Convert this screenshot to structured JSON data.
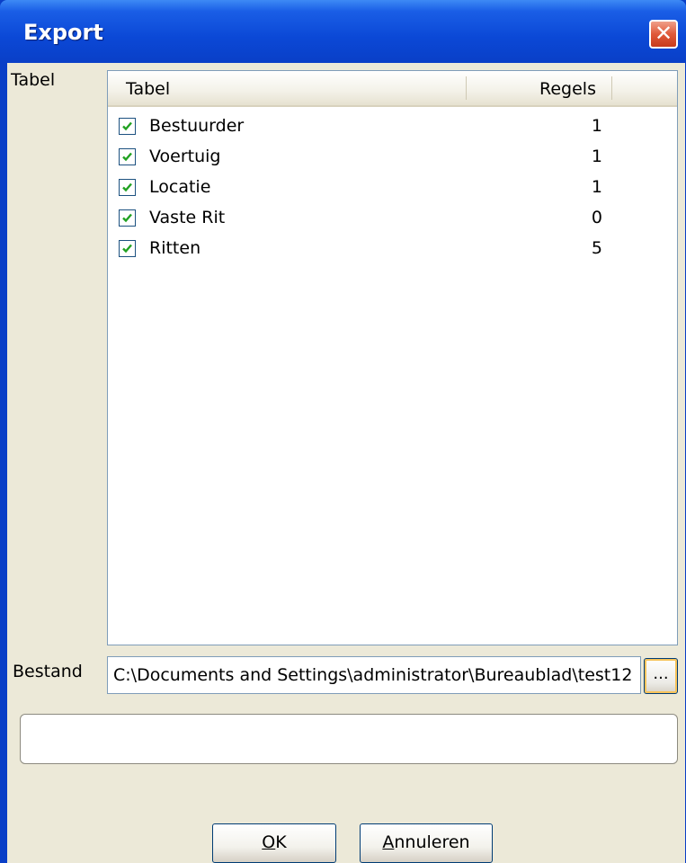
{
  "window": {
    "title": "Export",
    "close_glyph": "✕"
  },
  "labels": {
    "table": "Tabel",
    "file": "Bestand"
  },
  "list": {
    "columns": [
      "Tabel",
      "Regels"
    ],
    "rows": [
      {
        "name": "Bestuurder",
        "count": "1",
        "checked": true
      },
      {
        "name": "Voertuig",
        "count": "1",
        "checked": true
      },
      {
        "name": "Locatie",
        "count": "1",
        "checked": true
      },
      {
        "name": "Vaste Rit",
        "count": "0",
        "checked": true
      },
      {
        "name": "Ritten",
        "count": "5",
        "checked": true
      }
    ]
  },
  "file": {
    "value": "C:\\Documents and Settings\\administrator\\Bureaublad\\test12",
    "browse_label": "..."
  },
  "status": {
    "text": ""
  },
  "buttons": {
    "ok": {
      "mnemonic": "O",
      "rest": "K"
    },
    "cancel": {
      "mnemonic": "A",
      "rest": "nnuleren"
    }
  },
  "colors": {
    "titlebar": "#0a3fc7",
    "dialog_bg": "#ece9d8",
    "check": "#21a121",
    "close": "#e0593a"
  },
  "icons": {
    "close": "close-icon",
    "checkbox": "checkmark-icon"
  }
}
